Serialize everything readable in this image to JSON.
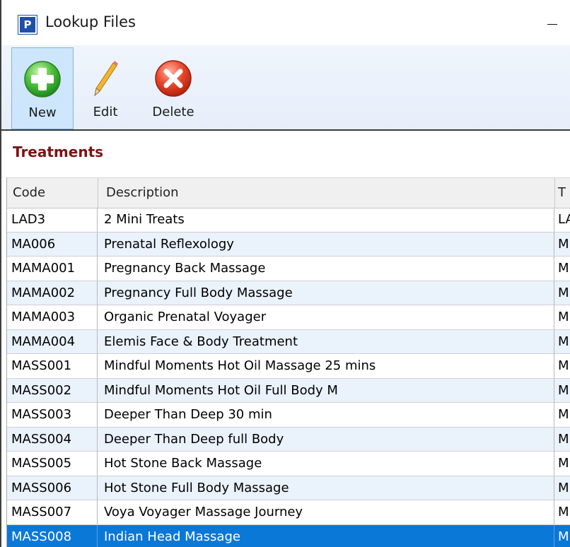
{
  "window": {
    "title": "Lookup Files",
    "icon_letter": "P",
    "minimize_glyph": "—"
  },
  "toolbar": {
    "buttons": [
      {
        "id": "new",
        "label": "New",
        "icon": "add-icon"
      },
      {
        "id": "edit",
        "label": "Edit",
        "icon": "pencil-icon"
      },
      {
        "id": "delete",
        "label": "Delete",
        "icon": "delete-icon"
      }
    ]
  },
  "section": {
    "title": "Treatments"
  },
  "grid": {
    "columns": [
      "Code",
      "Description",
      "T"
    ],
    "rows": [
      {
        "code": "LAD3",
        "description": "2 Mini Treats",
        "type": "LA"
      },
      {
        "code": "MA006",
        "description": "Prenatal Reflexology",
        "type": "M"
      },
      {
        "code": "MAMA001",
        "description": "Pregnancy Back Massage",
        "type": "M"
      },
      {
        "code": "MAMA002",
        "description": "Pregnancy Full Body Massage",
        "type": "M"
      },
      {
        "code": "MAMA003",
        "description": "Organic Prenatal Voyager",
        "type": "M"
      },
      {
        "code": "MAMA004",
        "description": "Elemis Face & Body Treatment",
        "type": "M"
      },
      {
        "code": "MASS001",
        "description": "Mindful Moments Hot Oil Massage 25 mins",
        "type": "M"
      },
      {
        "code": "MASS002",
        "description": "Mindful Moments Hot Oil Full Body M",
        "type": "M"
      },
      {
        "code": "MASS003",
        "description": "Deeper Than Deep 30 min",
        "type": "M"
      },
      {
        "code": "MASS004",
        "description": "Deeper Than Deep full Body",
        "type": "M"
      },
      {
        "code": "MASS005",
        "description": "Hot Stone Back Massage",
        "type": "M"
      },
      {
        "code": "MASS006",
        "description": "Hot Stone Full Body Massage",
        "type": "M"
      },
      {
        "code": "MASS007",
        "description": "Voya Voyager Massage Journey",
        "type": "M"
      },
      {
        "code": "MASS008",
        "description": "Indian Head Massage",
        "type": "M"
      }
    ],
    "selected_row": 13
  },
  "colors": {
    "accent_selected": "#0a78d7",
    "section_title": "#7a1414",
    "row_alt": "#eaf2fc"
  }
}
